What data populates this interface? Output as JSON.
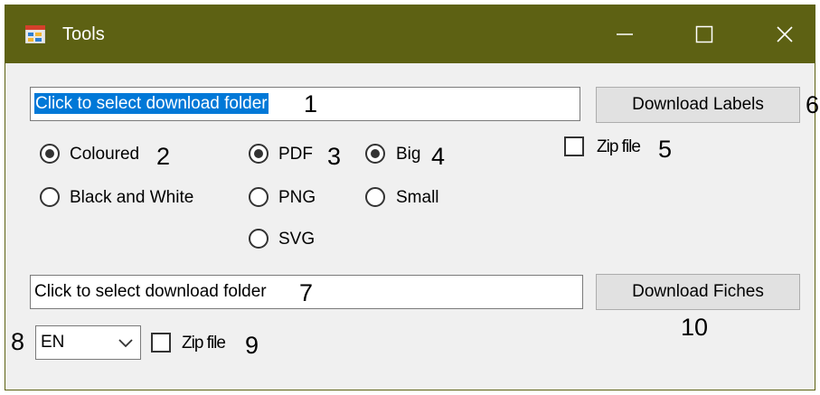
{
  "window": {
    "title": "Tools",
    "icon": "app-form-icon",
    "controls": [
      "minimize-icon",
      "maximize-icon",
      "close-icon"
    ],
    "titlebar_color": "#5d6113"
  },
  "labels_section": {
    "folder_input": {
      "value": "Click to select download folder",
      "annotation": "1"
    },
    "download_button": {
      "label": "Download Labels",
      "annotation": "6"
    },
    "color_mode": {
      "annotation": "2",
      "options": [
        {
          "label": "Coloured",
          "selected": true
        },
        {
          "label": "Black and White",
          "selected": false
        }
      ]
    },
    "format": {
      "annotation": "3",
      "options": [
        {
          "label": "PDF",
          "selected": true
        },
        {
          "label": "PNG",
          "selected": false
        },
        {
          "label": "SVG",
          "selected": false
        }
      ]
    },
    "size": {
      "annotation": "4",
      "options": [
        {
          "label": "Big",
          "selected": true
        },
        {
          "label": "Small",
          "selected": false
        }
      ]
    },
    "zip": {
      "label": "Zip file",
      "checked": false,
      "annotation": "5"
    }
  },
  "fiches_section": {
    "folder_input": {
      "value": "Click to select download folder",
      "annotation": "7"
    },
    "download_button": {
      "label": "Download Fiches",
      "annotation": "10"
    },
    "language": {
      "value": "EN",
      "annotation": "8"
    },
    "zip": {
      "label": "Zip file",
      "checked": false,
      "annotation": "9"
    }
  }
}
